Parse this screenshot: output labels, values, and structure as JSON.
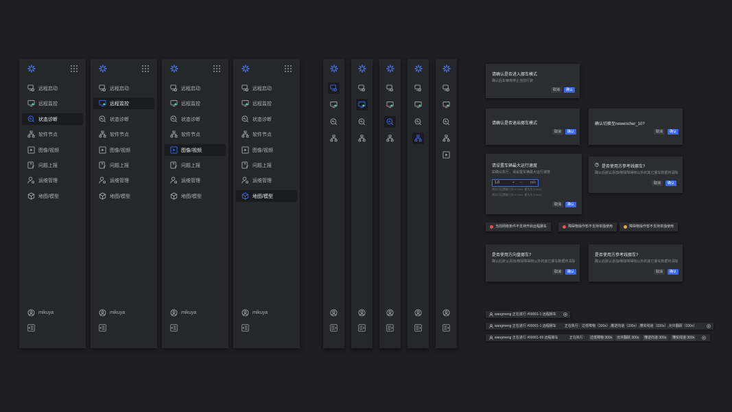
{
  "colors": {
    "accent": "#3867ed",
    "background": "#1f1f23",
    "panel": "#26272b",
    "error": "#e55454",
    "warning": "#e9a93a"
  },
  "menu": {
    "items": [
      {
        "key": "remote-start",
        "label": "远程启动",
        "icon": "remote-start-icon"
      },
      {
        "key": "remote-monitor",
        "label": "远程监控",
        "icon": "monitor-icon"
      },
      {
        "key": "status-diagnosis",
        "label": "状态诊断",
        "icon": "diagnosis-icon"
      },
      {
        "key": "software-node",
        "label": "软件节点",
        "icon": "node-tree-icon"
      },
      {
        "key": "image-video",
        "label": "图像/视频",
        "icon": "play-icon"
      },
      {
        "key": "issue-report",
        "label": "问题上报",
        "icon": "report-icon"
      },
      {
        "key": "ops-management",
        "label": "运维管理",
        "icon": "user-settings-icon"
      },
      {
        "key": "map-model",
        "label": "地图/模型",
        "icon": "cube-icon"
      }
    ],
    "user": "mikuya",
    "expanded_active": [
      2,
      1,
      4,
      7
    ],
    "collapsed_active": [
      1,
      2,
      3,
      4,
      6
    ]
  },
  "dialogs": {
    "enter_mode": {
      "title": "请确认是否进入挪车模式",
      "subtitle": "确认后车辆将停止当前行驶",
      "cancel": "取消",
      "ok": "确认"
    },
    "exit_mode": {
      "title": "请确认是否退出挪车模式",
      "cancel": "取消",
      "ok": "确认"
    },
    "switch": {
      "title": "确认切换至newencher_10?",
      "cancel": "取消",
      "ok": "确认"
    },
    "speed": {
      "title": "请设置车辆最大运行速度",
      "subtitle": "如确认执行，请设置车辆最大运行速度",
      "value": "1.0",
      "plus": "+",
      "minus": "−",
      "unit": "m/s",
      "hint1": "建议可设置最小为 0.1m/s, 最大为 4.0m/s",
      "hint2": "建议可设置最小为 0.1m/s, 最大为 4.0m/s",
      "cancel": "取消",
      "ok": "确认"
    },
    "reference": {
      "title": "是否使用方参考线挪车?",
      "subtitle": "确认后默认添加/移除障碍物以外的其它挪车数据将清除",
      "cancel": "取消",
      "ok": "确认"
    },
    "direction": {
      "title": "是否使用方向盘挪车?",
      "subtitle": "确认后默认添加/移除障碍物以外的其它挪车数据将清除",
      "cancel": "取消",
      "ok": "确认"
    },
    "reference2": {
      "title": "是否使用方参考线挪车?",
      "subtitle": "确认后默认添加/移除障碍物以外的其它挪车数据将清除",
      "cancel": "取消",
      "ok": "确认"
    }
  },
  "toasts": [
    {
      "text": "当前网络条件不支持开启远程挪车",
      "status": "error"
    },
    {
      "text": "障碍物操作暂不支持单独使用",
      "status": "error"
    },
    {
      "text": "障碍物操作暂不支持单独使用",
      "status": "warning"
    }
  ],
  "status_bars": [
    {
      "text": "wangmeng  正在进行 #00001-1 远程挪车",
      "chips": []
    },
    {
      "text": "wangmeng  正在进行 #00001-1 远程挪车",
      "extra": "正在执行：过低障物（330s）,撤逆向道（330s）,懂实线道（330s）,允许翻跃（330s）",
      "chips": []
    },
    {
      "text": "wangmeng  正在进行 #00001-99 远程挪车",
      "extra": "正在执行：",
      "chips": [
        "过低障物 300s",
        "允许翻跃 300s",
        "懂逆向道 300s",
        "懂实线道 300s"
      ]
    }
  ]
}
